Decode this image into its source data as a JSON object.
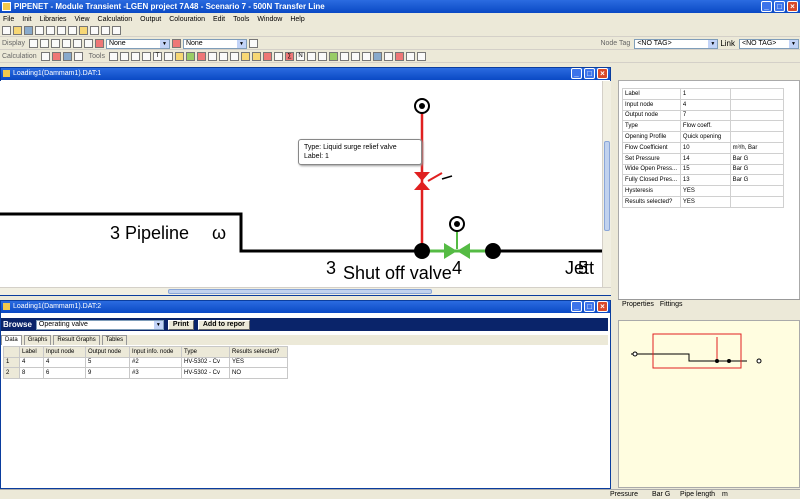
{
  "app": {
    "title": "PIPENET - Module Transient -LGEN project 7A48 - Scenario 7 - 500N Transfer Line",
    "window_buttons": [
      "_",
      "□",
      "×"
    ]
  },
  "menu": [
    "File",
    "Init",
    "Libraries",
    "View",
    "Calculation",
    "Output",
    "Colouration",
    "Edit",
    "Tools",
    "Window",
    "Help"
  ],
  "toolbar2": {
    "display_label": "Display",
    "combo1": "None",
    "combo2": "None",
    "node_tag_label": "Node Tag",
    "node_tag_value": "<NO TAG>",
    "link_label": "Link",
    "link_value": "<NO TAG>"
  },
  "toolbar3": {
    "calculation_label": "Calculation",
    "tools_label": "Tools",
    "letters": "T  ∑  N",
    "n_letter": "N"
  },
  "network_window": {
    "title": "Loading1(Dammam1).DAT:1",
    "tooltip_type": "Type:  Liquid surge relief valve",
    "tooltip_label": "Label: 1",
    "pipeline_label": "3 Pipeline",
    "pipeline_tag": "ω",
    "node_label": "3",
    "valve_label": "Shut off valve",
    "valve_num": "4",
    "right_label": "Jett",
    "right_num": "5"
  },
  "properties": {
    "rows": [
      [
        "Label",
        "1",
        ""
      ],
      [
        "Input node",
        "4",
        ""
      ],
      [
        "Output node",
        "7",
        ""
      ],
      [
        "Type",
        "Flow coeff.",
        ""
      ],
      [
        "Opening Profile",
        "Quick opening",
        ""
      ],
      [
        "Flow Coefficient",
        "10",
        "m³/h, Bar"
      ],
      [
        "Set Pressure",
        "14",
        "Bar G"
      ],
      [
        "Wide Open Press...",
        "15",
        "Bar G"
      ],
      [
        "Fully Closed Pres...",
        "13",
        "Bar G"
      ],
      [
        "Hysteresis",
        "YES",
        ""
      ],
      [
        "Results selected?",
        "YES",
        ""
      ]
    ],
    "tab_properties": "Properties",
    "tab_fittings": "Fittings"
  },
  "data_window": {
    "title": "Loading1(Dammam1).DAT:2",
    "browse_label": "Browse",
    "browse_value": "Operating valve",
    "print_button": "Print",
    "add_report_button": "Add to repor",
    "tabs": [
      "Data",
      "Graphs",
      "Result Graphs",
      "Tables"
    ],
    "columns": [
      "",
      "Label",
      "Input node",
      "Output node",
      "Input info. node",
      "Type",
      "Results selected?"
    ],
    "rows": [
      [
        "1",
        "4",
        "4",
        "5",
        "#2",
        "HV-5302 - Cv",
        "YES"
      ],
      [
        "2",
        "8",
        "6",
        "9",
        "#3",
        "HV-5302 - Cv",
        "NO"
      ]
    ]
  },
  "status": {
    "pressure": "Pressure",
    "pressure_unit": "Bar G",
    "pipe_length": "Pipe length",
    "length_unit": "m"
  },
  "colors": {
    "pipe": "#000000",
    "relief_line": "#e02020",
    "valve": "#55bb44",
    "titlebar": "#0a49c4"
  }
}
